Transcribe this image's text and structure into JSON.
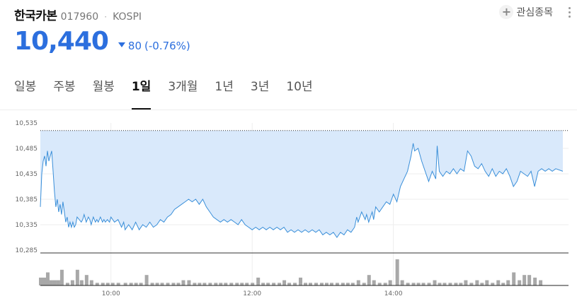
{
  "stock": {
    "name": "한국카본",
    "code": "017960",
    "separator": "·",
    "market": "KOSPI"
  },
  "actions": {
    "favorite_label": "관심종목"
  },
  "price": {
    "current": "10,440",
    "change": "80",
    "change_pct": "(-0.76%)",
    "direction": "down",
    "color": "#2c6fde"
  },
  "tabs": [
    {
      "label": "일봉",
      "active": false
    },
    {
      "label": "주봉",
      "active": false
    },
    {
      "label": "월봉",
      "active": false
    },
    {
      "label": "1일",
      "active": true
    },
    {
      "label": "3개월",
      "active": false
    },
    {
      "label": "1년",
      "active": false
    },
    {
      "label": "3년",
      "active": false
    },
    {
      "label": "10년",
      "active": false
    }
  ],
  "chart_data": {
    "type": "area",
    "y_ticks": [
      "10,535",
      "10,485",
      "10,435",
      "10,385",
      "10,335",
      "10,285"
    ],
    "x_ticks": [
      "10:00",
      "12:00",
      "14:00"
    ],
    "ylim": [
      10285,
      10535
    ],
    "prev_close": 10520,
    "line_color": "#3a8fd9",
    "fill_color": "#d9e9fb",
    "volume_color": "#a8a8a8",
    "price_series": [
      [
        9.0,
        10370
      ],
      [
        9.02,
        10435
      ],
      [
        9.04,
        10460
      ],
      [
        9.06,
        10470
      ],
      [
        9.08,
        10450
      ],
      [
        9.1,
        10480
      ],
      [
        9.12,
        10460
      ],
      [
        9.14,
        10470
      ],
      [
        9.16,
        10480
      ],
      [
        9.18,
        10440
      ],
      [
        9.2,
        10400
      ],
      [
        9.22,
        10370
      ],
      [
        9.24,
        10385
      ],
      [
        9.26,
        10360
      ],
      [
        9.28,
        10375
      ],
      [
        9.3,
        10355
      ],
      [
        9.32,
        10380
      ],
      [
        9.34,
        10360
      ],
      [
        9.36,
        10340
      ],
      [
        9.38,
        10350
      ],
      [
        9.4,
        10330
      ],
      [
        9.42,
        10340
      ],
      [
        9.44,
        10330
      ],
      [
        9.46,
        10340
      ],
      [
        9.48,
        10330
      ],
      [
        9.5,
        10335
      ],
      [
        9.52,
        10350
      ],
      [
        9.55,
        10345
      ],
      [
        9.58,
        10340
      ],
      [
        9.6,
        10345
      ],
      [
        9.62,
        10355
      ],
      [
        9.65,
        10340
      ],
      [
        9.68,
        10350
      ],
      [
        9.7,
        10345
      ],
      [
        9.72,
        10335
      ],
      [
        9.75,
        10350
      ],
      [
        9.78,
        10340
      ],
      [
        9.8,
        10345
      ],
      [
        9.82,
        10340
      ],
      [
        9.85,
        10350
      ],
      [
        9.88,
        10340
      ],
      [
        9.9,
        10345
      ],
      [
        9.92,
        10340
      ],
      [
        9.95,
        10345
      ],
      [
        9.98,
        10340
      ],
      [
        10.0,
        10350
      ],
      [
        10.05,
        10340
      ],
      [
        10.1,
        10345
      ],
      [
        10.15,
        10330
      ],
      [
        10.18,
        10340
      ],
      [
        10.2,
        10325
      ],
      [
        10.25,
        10335
      ],
      [
        10.3,
        10325
      ],
      [
        10.35,
        10340
      ],
      [
        10.4,
        10325
      ],
      [
        10.45,
        10335
      ],
      [
        10.5,
        10330
      ],
      [
        10.55,
        10340
      ],
      [
        10.6,
        10330
      ],
      [
        10.65,
        10335
      ],
      [
        10.7,
        10345
      ],
      [
        10.75,
        10340
      ],
      [
        10.8,
        10350
      ],
      [
        10.85,
        10355
      ],
      [
        10.9,
        10365
      ],
      [
        10.95,
        10370
      ],
      [
        11.0,
        10375
      ],
      [
        11.05,
        10380
      ],
      [
        11.1,
        10385
      ],
      [
        11.15,
        10380
      ],
      [
        11.2,
        10385
      ],
      [
        11.25,
        10375
      ],
      [
        11.3,
        10385
      ],
      [
        11.35,
        10370
      ],
      [
        11.4,
        10360
      ],
      [
        11.45,
        10350
      ],
      [
        11.5,
        10345
      ],
      [
        11.55,
        10340
      ],
      [
        11.6,
        10345
      ],
      [
        11.65,
        10340
      ],
      [
        11.7,
        10345
      ],
      [
        11.75,
        10340
      ],
      [
        11.8,
        10335
      ],
      [
        11.85,
        10345
      ],
      [
        11.9,
        10335
      ],
      [
        11.95,
        10330
      ],
      [
        12.0,
        10325
      ],
      [
        12.05,
        10330
      ],
      [
        12.1,
        10325
      ],
      [
        12.15,
        10330
      ],
      [
        12.2,
        10325
      ],
      [
        12.25,
        10330
      ],
      [
        12.3,
        10325
      ],
      [
        12.35,
        10330
      ],
      [
        12.4,
        10325
      ],
      [
        12.45,
        10330
      ],
      [
        12.5,
        10320
      ],
      [
        12.55,
        10325
      ],
      [
        12.6,
        10320
      ],
      [
        12.65,
        10325
      ],
      [
        12.7,
        10320
      ],
      [
        12.75,
        10325
      ],
      [
        12.8,
        10320
      ],
      [
        12.85,
        10325
      ],
      [
        12.9,
        10320
      ],
      [
        12.95,
        10325
      ],
      [
        13.0,
        10315
      ],
      [
        13.05,
        10320
      ],
      [
        13.1,
        10315
      ],
      [
        13.15,
        10320
      ],
      [
        13.2,
        10310
      ],
      [
        13.25,
        10320
      ],
      [
        13.3,
        10315
      ],
      [
        13.35,
        10325
      ],
      [
        13.4,
        10320
      ],
      [
        13.45,
        10330
      ],
      [
        13.48,
        10350
      ],
      [
        13.5,
        10340
      ],
      [
        13.55,
        10360
      ],
      [
        13.6,
        10345
      ],
      [
        13.62,
        10355
      ],
      [
        13.65,
        10340
      ],
      [
        13.7,
        10360
      ],
      [
        13.72,
        10345
      ],
      [
        13.75,
        10370
      ],
      [
        13.8,
        10360
      ],
      [
        13.85,
        10370
      ],
      [
        13.9,
        10380
      ],
      [
        13.95,
        10375
      ],
      [
        14.0,
        10395
      ],
      [
        14.05,
        10380
      ],
      [
        14.1,
        10410
      ],
      [
        14.15,
        10425
      ],
      [
        14.2,
        10440
      ],
      [
        14.25,
        10470
      ],
      [
        14.28,
        10495
      ],
      [
        14.3,
        10480
      ],
      [
        14.35,
        10485
      ],
      [
        14.4,
        10460
      ],
      [
        14.45,
        10440
      ],
      [
        14.5,
        10420
      ],
      [
        14.55,
        10440
      ],
      [
        14.6,
        10425
      ],
      [
        14.62,
        10490
      ],
      [
        14.65,
        10440
      ],
      [
        14.7,
        10430
      ],
      [
        14.75,
        10440
      ],
      [
        14.8,
        10435
      ],
      [
        14.85,
        10445
      ],
      [
        14.9,
        10435
      ],
      [
        14.95,
        10445
      ],
      [
        15.0,
        10440
      ],
      [
        15.05,
        10480
      ],
      [
        15.1,
        10470
      ],
      [
        15.15,
        10450
      ],
      [
        15.2,
        10445
      ],
      [
        15.25,
        10455
      ],
      [
        15.3,
        10440
      ],
      [
        15.35,
        10430
      ],
      [
        15.4,
        10445
      ],
      [
        15.45,
        10430
      ],
      [
        15.5,
        10440
      ],
      [
        15.55,
        10435
      ],
      [
        15.6,
        10445
      ],
      [
        15.65,
        10430
      ],
      [
        15.7,
        10410
      ],
      [
        15.75,
        10420
      ],
      [
        15.8,
        10440
      ],
      [
        15.85,
        10435
      ],
      [
        15.9,
        10430
      ],
      [
        15.95,
        10440
      ],
      [
        16.0,
        10410
      ],
      [
        16.05,
        10440
      ],
      [
        16.1,
        10445
      ],
      [
        16.15,
        10440
      ],
      [
        16.2,
        10445
      ],
      [
        16.25,
        10440
      ],
      [
        16.3,
        10445
      ],
      [
        16.4,
        10440
      ]
    ],
    "volume_series": [
      [
        9.0,
        3
      ],
      [
        9.05,
        3
      ],
      [
        9.1,
        5
      ],
      [
        9.15,
        2
      ],
      [
        9.2,
        2
      ],
      [
        9.25,
        2
      ],
      [
        9.3,
        6
      ],
      [
        9.38,
        1
      ],
      [
        9.45,
        2
      ],
      [
        9.52,
        6
      ],
      [
        9.58,
        2
      ],
      [
        9.65,
        4
      ],
      [
        9.72,
        2
      ],
      [
        9.8,
        1
      ],
      [
        9.88,
        1
      ],
      [
        9.95,
        1
      ],
      [
        10.02,
        1
      ],
      [
        10.1,
        1
      ],
      [
        10.2,
        1
      ],
      [
        10.28,
        1
      ],
      [
        10.35,
        1
      ],
      [
        10.42,
        1
      ],
      [
        10.5,
        4
      ],
      [
        10.58,
        1
      ],
      [
        10.65,
        1
      ],
      [
        10.72,
        1
      ],
      [
        10.8,
        1
      ],
      [
        10.88,
        1
      ],
      [
        10.95,
        1
      ],
      [
        11.02,
        2
      ],
      [
        11.1,
        2
      ],
      [
        11.18,
        1
      ],
      [
        11.25,
        1
      ],
      [
        11.32,
        1
      ],
      [
        11.4,
        1
      ],
      [
        11.48,
        1
      ],
      [
        11.55,
        1
      ],
      [
        11.62,
        1
      ],
      [
        11.7,
        1
      ],
      [
        11.78,
        1
      ],
      [
        11.85,
        1
      ],
      [
        11.92,
        1
      ],
      [
        12.0,
        1
      ],
      [
        12.08,
        3
      ],
      [
        12.15,
        1
      ],
      [
        12.22,
        1
      ],
      [
        12.3,
        1
      ],
      [
        12.38,
        1
      ],
      [
        12.45,
        2
      ],
      [
        12.52,
        1
      ],
      [
        12.6,
        1
      ],
      [
        12.68,
        3
      ],
      [
        12.75,
        1
      ],
      [
        12.82,
        1
      ],
      [
        12.9,
        1
      ],
      [
        12.98,
        1
      ],
      [
        13.05,
        1
      ],
      [
        13.12,
        1
      ],
      [
        13.2,
        1
      ],
      [
        13.28,
        1
      ],
      [
        13.35,
        1
      ],
      [
        13.42,
        1
      ],
      [
        13.5,
        2
      ],
      [
        13.58,
        1
      ],
      [
        13.65,
        4
      ],
      [
        13.72,
        2
      ],
      [
        13.8,
        1
      ],
      [
        13.88,
        1
      ],
      [
        13.95,
        2
      ],
      [
        14.05,
        10
      ],
      [
        14.12,
        2
      ],
      [
        14.2,
        1
      ],
      [
        14.28,
        1
      ],
      [
        14.35,
        1
      ],
      [
        14.42,
        1
      ],
      [
        14.5,
        1
      ],
      [
        14.58,
        2
      ],
      [
        14.65,
        1
      ],
      [
        14.72,
        1
      ],
      [
        14.8,
        1
      ],
      [
        14.88,
        1
      ],
      [
        14.95,
        1
      ],
      [
        15.02,
        2
      ],
      [
        15.1,
        1
      ],
      [
        15.18,
        2
      ],
      [
        15.25,
        1
      ],
      [
        15.32,
        2
      ],
      [
        15.4,
        1
      ],
      [
        15.48,
        2
      ],
      [
        15.55,
        1
      ],
      [
        15.62,
        2
      ],
      [
        15.7,
        5
      ],
      [
        15.78,
        2
      ],
      [
        15.85,
        4
      ],
      [
        15.92,
        4
      ],
      [
        16.0,
        3
      ],
      [
        16.08,
        2
      ]
    ]
  }
}
